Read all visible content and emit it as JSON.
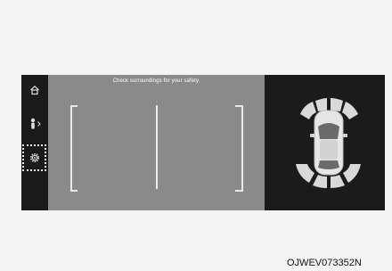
{
  "camera": {
    "message": "Check surroundings for your safety."
  },
  "sidebar": {
    "items": [
      {
        "icon": "home-icon"
      },
      {
        "icon": "person-icon"
      },
      {
        "icon": "settings-icon"
      }
    ]
  },
  "caption": "OJWEV073352N",
  "colors": {
    "screen_bg": "#1c1c1c",
    "camera_bg": "#8a8a8a",
    "guide_line": "#e0e0e0",
    "sensor_zone": "#d9d9d9"
  }
}
